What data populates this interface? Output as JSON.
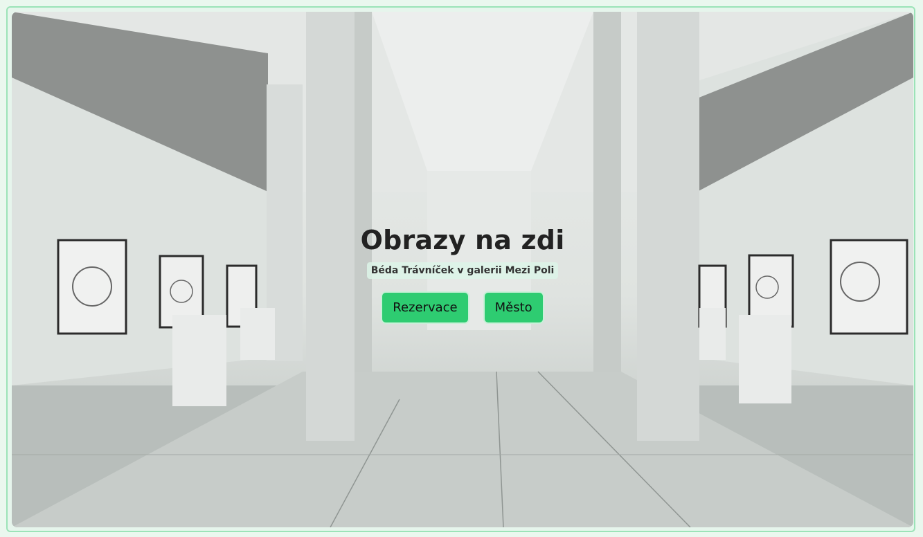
{
  "hero": {
    "title": "Obrazy na zdi",
    "subtitle": "Béda Trávníček v galerii Mezi Poli",
    "image_description": "gallery-interior-photo"
  },
  "buttons": {
    "reservation": "Rezervace",
    "city": "Město"
  },
  "colors": {
    "accent": "#2ecc71",
    "frame_border": "#9be3b7",
    "page_bg": "#eaf7ee"
  }
}
